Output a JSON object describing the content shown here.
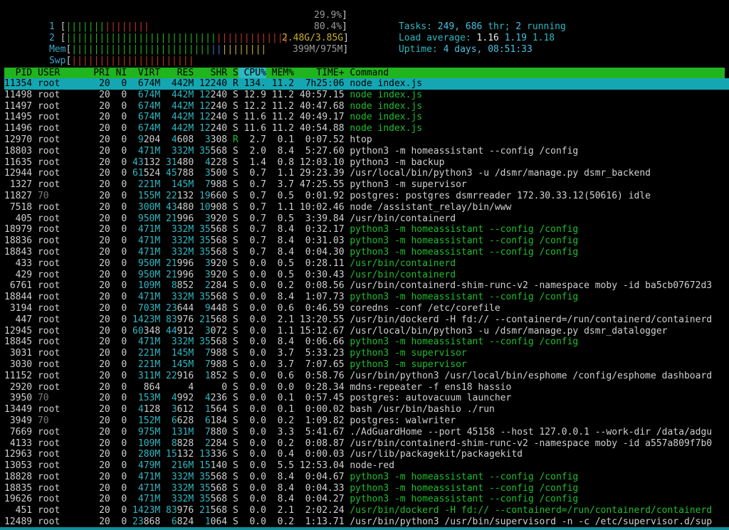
{
  "meters": {
    "cpu1": {
      "label": "1",
      "percent": "29.9%",
      "value": 29.9
    },
    "cpu2": {
      "label": "2",
      "percent": "80.4%",
      "value": 80.4
    },
    "mem": {
      "label": "Mem",
      "text": "2.48G/3.85G",
      "used_gb": 2.48,
      "total_gb": 3.85
    },
    "swp": {
      "label": "Swp",
      "text": "399M/975M",
      "used_mb": 399,
      "total_mb": 975
    }
  },
  "info": {
    "tasks_label": "Tasks:",
    "tasks": "249,",
    "threads": "686",
    "thr_label": "thr;",
    "running": "2",
    "running_label": "running",
    "load_label": "Load average:",
    "load1": "1.16",
    "load5": "1.19",
    "load15": "1.18",
    "uptime_label": "Uptime:",
    "uptime": "4 days, 08:51:33"
  },
  "columns": [
    "PID",
    "USER",
    "PRI",
    "NI",
    "VIRT",
    "RES",
    "SHR",
    "S",
    "CPU%",
    "MEM%",
    "TIME+",
    "Command"
  ],
  "processes": [
    {
      "pid": "11354",
      "user": "root",
      "pri": "20",
      "ni": "0",
      "virt": "674M",
      "res": "442M",
      "shr": "12240",
      "s": "R",
      "cpu": "134.",
      "mem": "11.2",
      "time": "7h25:06",
      "cmd": "node index.js",
      "selected": true
    },
    {
      "pid": "11498",
      "user": "root",
      "pri": "20",
      "ni": "0",
      "virt": "674M",
      "res": "442M",
      "shr": "12240",
      "s": "S",
      "cpu": "12.9",
      "mem": "11.2",
      "time": "40:57.15",
      "cmd": "node index.js",
      "thread": true
    },
    {
      "pid": "11497",
      "user": "root",
      "pri": "20",
      "ni": "0",
      "virt": "674M",
      "res": "442M",
      "shr": "12240",
      "s": "S",
      "cpu": "12.2",
      "mem": "11.2",
      "time": "40:47.68",
      "cmd": "node index.js",
      "thread": true
    },
    {
      "pid": "11495",
      "user": "root",
      "pri": "20",
      "ni": "0",
      "virt": "674M",
      "res": "442M",
      "shr": "12240",
      "s": "S",
      "cpu": "11.6",
      "mem": "11.2",
      "time": "40:49.17",
      "cmd": "node index.js",
      "thread": true
    },
    {
      "pid": "11496",
      "user": "root",
      "pri": "20",
      "ni": "0",
      "virt": "674M",
      "res": "442M",
      "shr": "12240",
      "s": "S",
      "cpu": "11.6",
      "mem": "11.2",
      "time": "40:54.88",
      "cmd": "node index.js",
      "thread": true
    },
    {
      "pid": "12970",
      "user": "root",
      "pri": "20",
      "ni": "0",
      "virt": "9204",
      "res": "4608",
      "shr": "3308",
      "s": "R",
      "cpu": "2.7",
      "mem": "0.1",
      "time": "0:07.52",
      "cmd": "htop"
    },
    {
      "pid": "18803",
      "user": "root",
      "pri": "20",
      "ni": "0",
      "virt": "471M",
      "res": "332M",
      "shr": "35568",
      "s": "S",
      "cpu": "2.0",
      "mem": "8.4",
      "time": "5:27.60",
      "cmd": "python3 -m homeassistant --config /config"
    },
    {
      "pid": "11635",
      "user": "root",
      "pri": "20",
      "ni": "0",
      "virt": "43132",
      "res": "31480",
      "shr": "4228",
      "s": "S",
      "cpu": "1.4",
      "mem": "0.8",
      "time": "12:03.10",
      "cmd": "python3 -m backup"
    },
    {
      "pid": "12944",
      "user": "root",
      "pri": "20",
      "ni": "0",
      "virt": "61524",
      "res": "45788",
      "shr": "3500",
      "s": "S",
      "cpu": "0.7",
      "mem": "1.1",
      "time": "29:23.39",
      "cmd": "/usr/local/bin/python3 -u /dsmr/manage.py dsmr_backend"
    },
    {
      "pid": "1327",
      "user": "root",
      "pri": "20",
      "ni": "0",
      "virt": "221M",
      "res": "145M",
      "shr": "7988",
      "s": "S",
      "cpu": "0.7",
      "mem": "3.7",
      "time": "47:25.55",
      "cmd": "python3 -m supervisor"
    },
    {
      "pid": "11827",
      "user": "70",
      "pri": "20",
      "ni": "0",
      "virt": "155M",
      "res": "22132",
      "shr": "19660",
      "s": "S",
      "cpu": "0.7",
      "mem": "0.5",
      "time": "0:01.92",
      "cmd": "postgres: postgres dsmrreader 172.30.33.12(50616) idle"
    },
    {
      "pid": "7518",
      "user": "root",
      "pri": "20",
      "ni": "0",
      "virt": "300M",
      "res": "43480",
      "shr": "10908",
      "s": "S",
      "cpu": "0.7",
      "mem": "1.1",
      "time": "10:02.46",
      "cmd": "node /assistant_relay/bin/www"
    },
    {
      "pid": "405",
      "user": "root",
      "pri": "20",
      "ni": "0",
      "virt": "950M",
      "res": "21996",
      "shr": "3920",
      "s": "S",
      "cpu": "0.7",
      "mem": "0.5",
      "time": "3:39.84",
      "cmd": "/usr/bin/containerd"
    },
    {
      "pid": "18979",
      "user": "root",
      "pri": "20",
      "ni": "0",
      "virt": "471M",
      "res": "332M",
      "shr": "35568",
      "s": "S",
      "cpu": "0.7",
      "mem": "8.4",
      "time": "0:32.17",
      "cmd": "python3 -m homeassistant --config /config",
      "thread": true
    },
    {
      "pid": "18836",
      "user": "root",
      "pri": "20",
      "ni": "0",
      "virt": "471M",
      "res": "332M",
      "shr": "35568",
      "s": "S",
      "cpu": "0.7",
      "mem": "8.4",
      "time": "0:31.03",
      "cmd": "python3 -m homeassistant --config /config",
      "thread": true
    },
    {
      "pid": "18843",
      "user": "root",
      "pri": "20",
      "ni": "0",
      "virt": "471M",
      "res": "332M",
      "shr": "35568",
      "s": "S",
      "cpu": "0.7",
      "mem": "8.4",
      "time": "0:04.30",
      "cmd": "python3 -m homeassistant --config /config",
      "thread": true
    },
    {
      "pid": "433",
      "user": "root",
      "pri": "20",
      "ni": "0",
      "virt": "950M",
      "res": "21996",
      "shr": "3920",
      "s": "S",
      "cpu": "0.0",
      "mem": "0.5",
      "time": "0:28.11",
      "cmd": "/usr/bin/containerd",
      "thread": true
    },
    {
      "pid": "429",
      "user": "root",
      "pri": "20",
      "ni": "0",
      "virt": "950M",
      "res": "21996",
      "shr": "3920",
      "s": "S",
      "cpu": "0.0",
      "mem": "0.5",
      "time": "0:30.43",
      "cmd": "/usr/bin/containerd",
      "thread": true
    },
    {
      "pid": "6761",
      "user": "root",
      "pri": "20",
      "ni": "0",
      "virt": "109M",
      "res": "8852",
      "shr": "2284",
      "s": "S",
      "cpu": "0.0",
      "mem": "0.2",
      "time": "0:08.56",
      "cmd": "/usr/bin/containerd-shim-runc-v2 -namespace moby -id ba5cb07672d3"
    },
    {
      "pid": "18844",
      "user": "root",
      "pri": "20",
      "ni": "0",
      "virt": "471M",
      "res": "332M",
      "shr": "35568",
      "s": "S",
      "cpu": "0.0",
      "mem": "8.4",
      "time": "1:07.73",
      "cmd": "python3 -m homeassistant --config /config",
      "thread": true
    },
    {
      "pid": "3194",
      "user": "root",
      "pri": "20",
      "ni": "0",
      "virt": "703M",
      "res": "23644",
      "shr": "9448",
      "s": "S",
      "cpu": "0.0",
      "mem": "0.6",
      "time": "0:46.59",
      "cmd": "coredns -conf /etc/corefile"
    },
    {
      "pid": "447",
      "user": "root",
      "pri": "20",
      "ni": "0",
      "virt": "1423M",
      "res": "83976",
      "shr": "21568",
      "s": "S",
      "cpu": "0.0",
      "mem": "2.1",
      "time": "13:20.55",
      "cmd": "/usr/bin/dockerd -H fd:// --containerd=/run/containerd/containerd"
    },
    {
      "pid": "12945",
      "user": "root",
      "pri": "20",
      "ni": "0",
      "virt": "60348",
      "res": "44912",
      "shr": "3072",
      "s": "S",
      "cpu": "0.0",
      "mem": "1.1",
      "time": "15:12.67",
      "cmd": "/usr/local/bin/python3 -u /dsmr/manage.py dsmr_datalogger"
    },
    {
      "pid": "18845",
      "user": "root",
      "pri": "20",
      "ni": "0",
      "virt": "471M",
      "res": "332M",
      "shr": "35568",
      "s": "S",
      "cpu": "0.0",
      "mem": "8.4",
      "time": "0:06.66",
      "cmd": "python3 -m homeassistant --config /config",
      "thread": true
    },
    {
      "pid": "3031",
      "user": "root",
      "pri": "20",
      "ni": "0",
      "virt": "221M",
      "res": "145M",
      "shr": "7988",
      "s": "S",
      "cpu": "0.0",
      "mem": "3.7",
      "time": "5:33.23",
      "cmd": "python3 -m supervisor",
      "thread": true
    },
    {
      "pid": "3030",
      "user": "root",
      "pri": "20",
      "ni": "0",
      "virt": "221M",
      "res": "145M",
      "shr": "7988",
      "s": "S",
      "cpu": "0.0",
      "mem": "3.7",
      "time": "7:07.65",
      "cmd": "python3 -m supervisor",
      "thread": true
    },
    {
      "pid": "11152",
      "user": "root",
      "pri": "20",
      "ni": "0",
      "virt": "311M",
      "res": "22916",
      "shr": "1852",
      "s": "S",
      "cpu": "0.0",
      "mem": "0.6",
      "time": "0:58.76",
      "cmd": "/usr/bin/python3 /usr/local/bin/esphome /config/esphome dashboard"
    },
    {
      "pid": "2920",
      "user": "root",
      "pri": "20",
      "ni": "0",
      "virt": "864",
      "res": "4",
      "shr": "0",
      "s": "S",
      "cpu": "0.0",
      "mem": "0.0",
      "time": "0:28.34",
      "cmd": "mdns-repeater -f ens18 hassio"
    },
    {
      "pid": "3950",
      "user": "70",
      "pri": "20",
      "ni": "0",
      "virt": "153M",
      "res": "4992",
      "shr": "4236",
      "s": "S",
      "cpu": "0.0",
      "mem": "0.1",
      "time": "0:57.45",
      "cmd": "postgres: autovacuum launcher"
    },
    {
      "pid": "13449",
      "user": "root",
      "pri": "20",
      "ni": "0",
      "virt": "4128",
      "res": "3612",
      "shr": "1564",
      "s": "S",
      "cpu": "0.0",
      "mem": "0.1",
      "time": "0:00.02",
      "cmd": "bash /usr/bin/bashio ./run"
    },
    {
      "pid": "3949",
      "user": "70",
      "pri": "20",
      "ni": "0",
      "virt": "152M",
      "res": "6628",
      "shr": "6184",
      "s": "S",
      "cpu": "0.0",
      "mem": "0.2",
      "time": "1:09.82",
      "cmd": "postgres: walwriter"
    },
    {
      "pid": "7669",
      "user": "root",
      "pri": "20",
      "ni": "0",
      "virt": "975M",
      "res": "131M",
      "shr": "7880",
      "s": "S",
      "cpu": "0.0",
      "mem": "3.3",
      "time": "5:41.67",
      "cmd": "./AdGuardHome --port 45158 --host 127.0.0.1 --work-dir /data/adgu"
    },
    {
      "pid": "4133",
      "user": "root",
      "pri": "20",
      "ni": "0",
      "virt": "109M",
      "res": "8828",
      "shr": "2284",
      "s": "S",
      "cpu": "0.0",
      "mem": "0.2",
      "time": "0:08.87",
      "cmd": "/usr/bin/containerd-shim-runc-v2 -namespace moby -id a557a809f7b0"
    },
    {
      "pid": "12963",
      "user": "root",
      "pri": "20",
      "ni": "0",
      "virt": "280M",
      "res": "15132",
      "shr": "13336",
      "s": "S",
      "cpu": "0.0",
      "mem": "0.4",
      "time": "0:00.03",
      "cmd": "/usr/lib/packagekit/packagekitd"
    },
    {
      "pid": "13053",
      "user": "root",
      "pri": "20",
      "ni": "0",
      "virt": "479M",
      "res": "216M",
      "shr": "15140",
      "s": "S",
      "cpu": "0.0",
      "mem": "5.5",
      "time": "12:53.04",
      "cmd": "node-red"
    },
    {
      "pid": "18828",
      "user": "root",
      "pri": "20",
      "ni": "0",
      "virt": "471M",
      "res": "332M",
      "shr": "35568",
      "s": "S",
      "cpu": "0.0",
      "mem": "8.4",
      "time": "0:04.67",
      "cmd": "python3 -m homeassistant --config /config",
      "thread": true
    },
    {
      "pid": "18835",
      "user": "root",
      "pri": "20",
      "ni": "0",
      "virt": "471M",
      "res": "332M",
      "shr": "35568",
      "s": "S",
      "cpu": "0.0",
      "mem": "8.4",
      "time": "0:04.33",
      "cmd": "python3 -m homeassistant --config /config",
      "thread": true
    },
    {
      "pid": "19626",
      "user": "root",
      "pri": "20",
      "ni": "0",
      "virt": "471M",
      "res": "332M",
      "shr": "35568",
      "s": "S",
      "cpu": "0.0",
      "mem": "8.4",
      "time": "0:04.27",
      "cmd": "python3 -m homeassistant --config /config",
      "thread": true
    },
    {
      "pid": "451",
      "user": "root",
      "pri": "20",
      "ni": "0",
      "virt": "1423M",
      "res": "83976",
      "shr": "21568",
      "s": "S",
      "cpu": "0.0",
      "mem": "2.1",
      "time": "2:02.24",
      "cmd": "/usr/bin/dockerd -H fd:// --containerd=/run/containerd/containerd",
      "thread": true
    },
    {
      "pid": "12489",
      "user": "root",
      "pri": "20",
      "ni": "0",
      "virt": "23868",
      "res": "6824",
      "shr": "1064",
      "s": "S",
      "cpu": "0.0",
      "mem": "0.2",
      "time": "1:13.71",
      "cmd": "/usr/bin/python3 /usr/bin/supervisord -n -c /etc/supervisor.d/sup"
    }
  ],
  "colors": {
    "header_bg": "#20b41e",
    "selected_bg": "#14a7b3",
    "accent": "#2fb7c2",
    "thread": "#1fbe2d"
  }
}
